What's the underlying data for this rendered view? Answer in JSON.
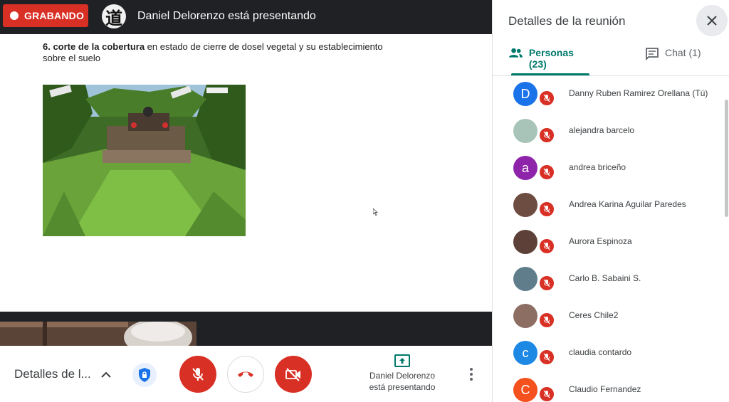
{
  "recording": {
    "label": "GRABANDO"
  },
  "presenter": {
    "avatar_glyph": "道",
    "title": "Daniel Delorenzo está presentando"
  },
  "slide": {
    "bold_text": "6. corte de la cobertura",
    "line1_rest": " en estado de cierre de dosel vegetal y su establecimiento",
    "line2": "sobre el suelo"
  },
  "bottombar": {
    "meeting_details_label": "Detalles de l...",
    "present_status_line1": "Daniel Delorenzo",
    "present_status_line2": "está presentando"
  },
  "panel": {
    "title": "Detalles de la reunión",
    "tab_people": "Personas (23)",
    "tab_chat": "Chat (1)"
  },
  "people": [
    {
      "name": "Danny Ruben Ramirez Orellana (Tú)",
      "initial": "D",
      "color": "#1a73e8"
    },
    {
      "name": "alejandra barcelo",
      "initial": "",
      "color": "#a8c4b8"
    },
    {
      "name": "andrea briceño",
      "initial": "a",
      "color": "#8e24aa"
    },
    {
      "name": "Andrea Karina Aguilar Paredes",
      "initial": "",
      "color": "#6d4c41"
    },
    {
      "name": "Aurora Espinoza",
      "initial": "",
      "color": "#5d4037"
    },
    {
      "name": "Carlo B. Sabaini S.",
      "initial": "",
      "color": "#607d8b"
    },
    {
      "name": "Ceres Chile2",
      "initial": "",
      "color": "#8d6e63"
    },
    {
      "name": "claudia contardo",
      "initial": "c",
      "color": "#1e88e5"
    },
    {
      "name": "Claudio Fernandez",
      "initial": "C",
      "color": "#f4511e"
    }
  ],
  "colors": {
    "danger": "#d93025",
    "accent": "#00796b",
    "dark": "#202124"
  }
}
